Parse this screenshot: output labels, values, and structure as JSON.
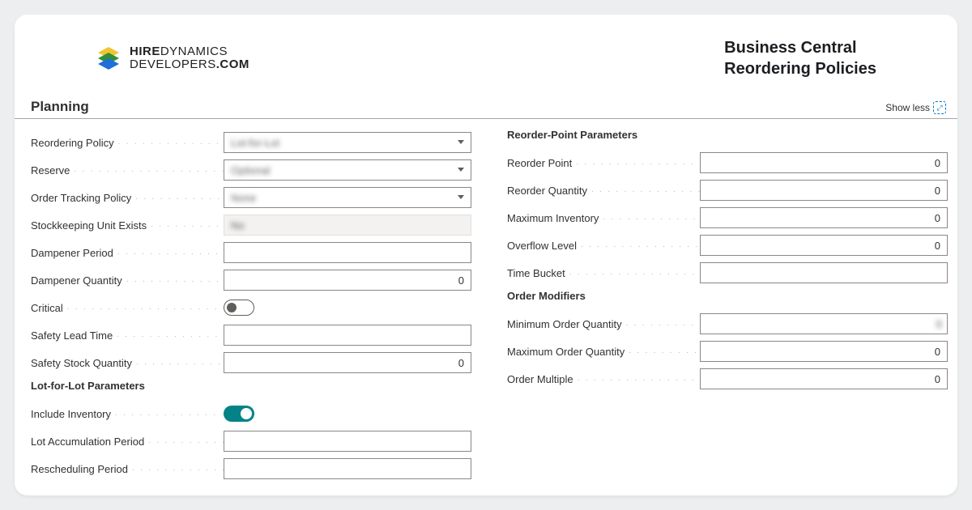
{
  "logo": {
    "line1_a": "HIRE",
    "line1_b": "DYNAMICS",
    "line2_a": "DEVELOPERS",
    "line2_b": ".COM"
  },
  "title": {
    "line1": "Business Central",
    "line2": "Reordering Policies"
  },
  "panel": {
    "heading": "Planning",
    "show_less": "Show less"
  },
  "left": {
    "reordering_policy": {
      "label": "Reordering Policy",
      "value": "Lot-for-Lot"
    },
    "reserve": {
      "label": "Reserve",
      "value": "Optional"
    },
    "order_tracking_policy": {
      "label": "Order Tracking Policy",
      "value": "None"
    },
    "stockkeeping_unit_exists": {
      "label": "Stockkeeping Unit Exists",
      "value": "No"
    },
    "dampener_period": {
      "label": "Dampener Period",
      "value": ""
    },
    "dampener_quantity": {
      "label": "Dampener Quantity",
      "value": "0"
    },
    "critical": {
      "label": "Critical",
      "on": false
    },
    "safety_lead_time": {
      "label": "Safety Lead Time",
      "value": ""
    },
    "safety_stock_quantity": {
      "label": "Safety Stock Quantity",
      "value": "0"
    },
    "lot_header": "Lot-for-Lot Parameters",
    "include_inventory": {
      "label": "Include Inventory",
      "on": true
    },
    "lot_accumulation_period": {
      "label": "Lot Accumulation Period",
      "value": ""
    },
    "rescheduling_period": {
      "label": "Rescheduling Period",
      "value": ""
    }
  },
  "right": {
    "reorder_header": "Reorder-Point Parameters",
    "reorder_point": {
      "label": "Reorder Point",
      "value": "0"
    },
    "reorder_quantity": {
      "label": "Reorder Quantity",
      "value": "0"
    },
    "maximum_inventory": {
      "label": "Maximum Inventory",
      "value": "0"
    },
    "overflow_level": {
      "label": "Overflow Level",
      "value": "0"
    },
    "time_bucket": {
      "label": "Time Bucket",
      "value": ""
    },
    "modifiers_header": "Order Modifiers",
    "minimum_order_quantity": {
      "label": "Minimum Order Quantity",
      "value": "0"
    },
    "maximum_order_quantity": {
      "label": "Maximum Order Quantity",
      "value": "0"
    },
    "order_multiple": {
      "label": "Order Multiple",
      "value": "0"
    }
  }
}
